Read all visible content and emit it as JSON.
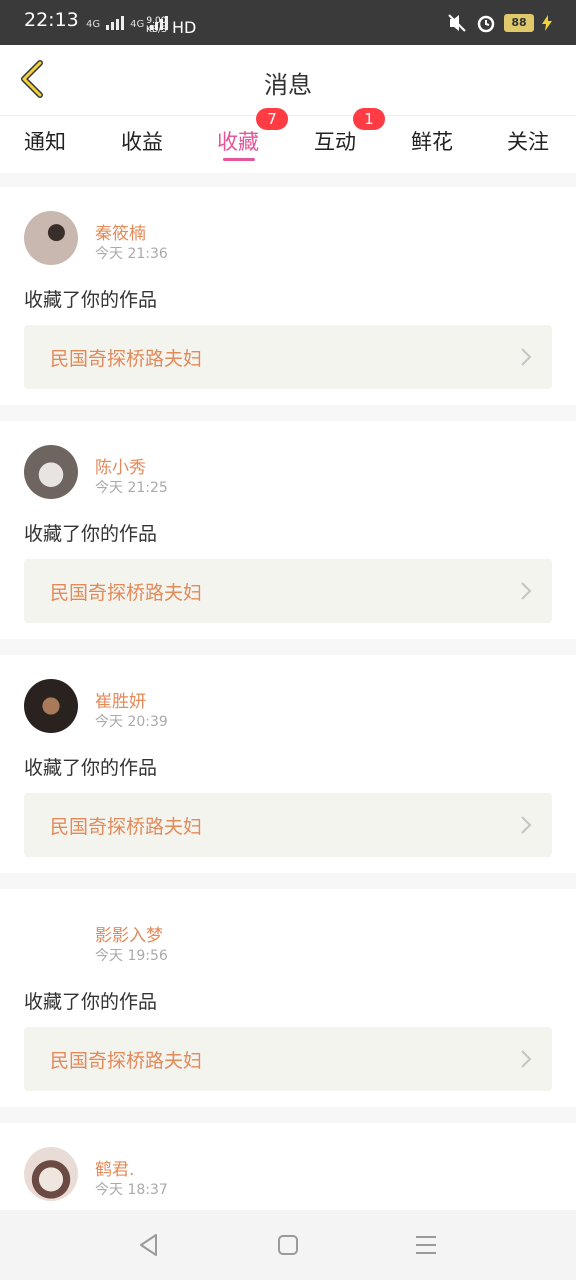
{
  "status_bar": {
    "time": "22:13",
    "network1": "4G",
    "network2": "4G",
    "speed_value": "9.00",
    "speed_unit": "KB/S",
    "hd": "HD",
    "battery": "88"
  },
  "header": {
    "title": "消息"
  },
  "tabs": [
    {
      "label": "通知"
    },
    {
      "label": "收益"
    },
    {
      "label": "收藏",
      "badge": "7"
    },
    {
      "label": "互动",
      "badge": "1"
    },
    {
      "label": "鲜花"
    },
    {
      "label": "关注"
    }
  ],
  "feed": [
    {
      "name": "秦筱楠",
      "time": "今天 21:36",
      "action": "收藏了你的作品",
      "work": "民国奇探桥路夫妇",
      "avatar_color": "#b8a8a0"
    },
    {
      "name": "陈小秀",
      "time": "今天 21:25",
      "action": "收藏了你的作品",
      "work": "民国奇探桥路夫妇",
      "avatar_color": "#8a7f7a"
    },
    {
      "name": "崔胜妍",
      "time": "今天 20:39",
      "action": "收藏了你的作品",
      "work": "民国奇探桥路夫妇",
      "avatar_color": "#4a3a30"
    },
    {
      "name": "影影入梦",
      "time": "今天 19:56",
      "action": "收藏了你的作品",
      "work": "民国奇探桥路夫妇",
      "avatar_color": "#ffffff"
    },
    {
      "name": "鹤君.",
      "time": "今天 18:37",
      "action": "",
      "work": "",
      "avatar_color": "#d9c9c4"
    }
  ],
  "colors": {
    "accent": "#e4559a",
    "name": "#e38a5a",
    "badge": "#ff3b44"
  }
}
